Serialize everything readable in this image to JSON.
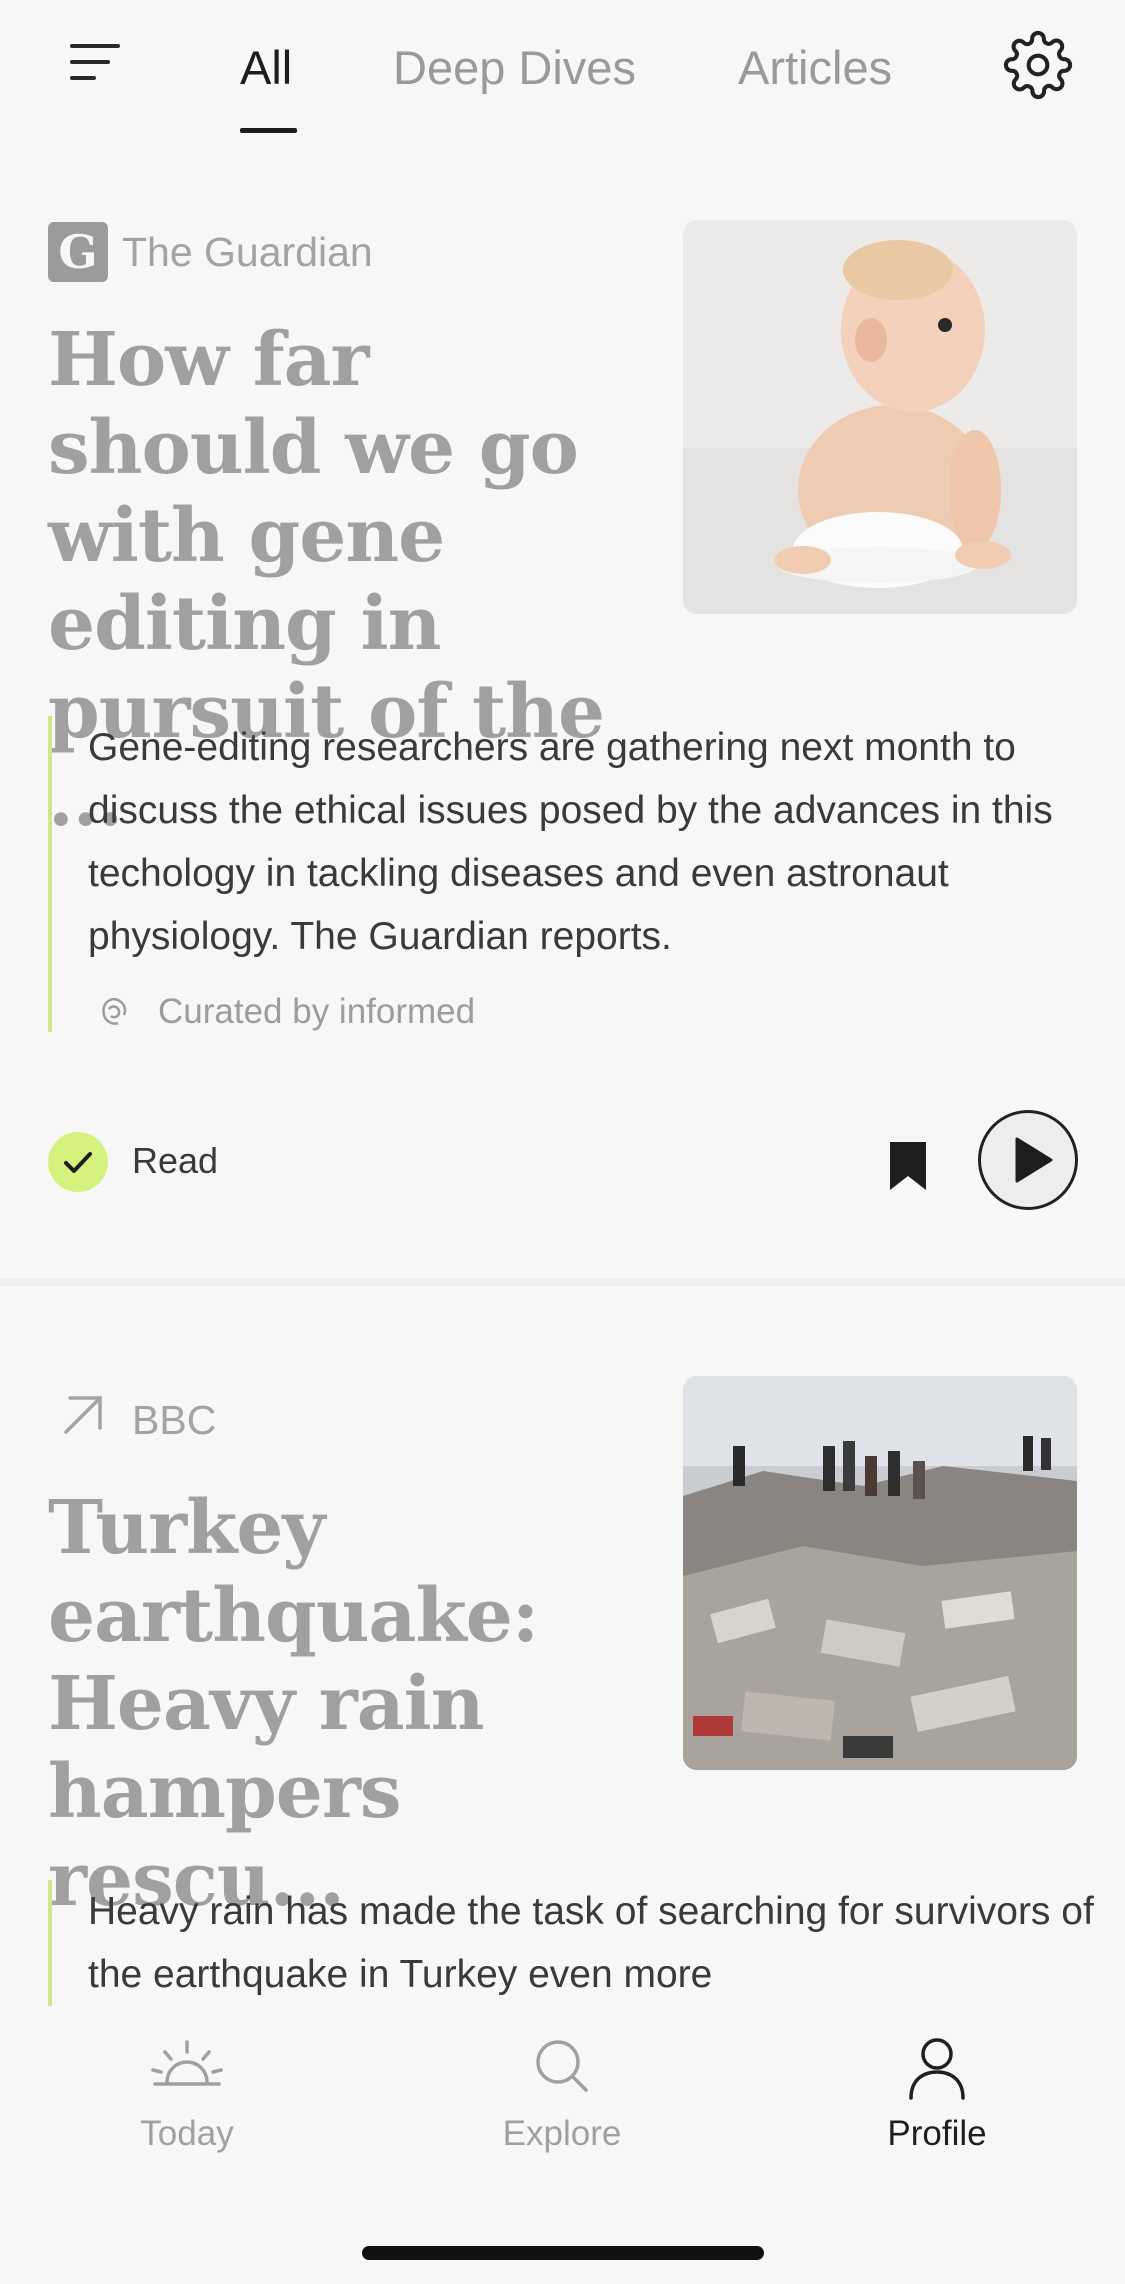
{
  "tabs": [
    {
      "label": "All",
      "active": true
    },
    {
      "label": "Deep Dives",
      "active": false
    },
    {
      "label": "Articles",
      "active": false
    }
  ],
  "cards": [
    {
      "source": "The Guardian",
      "source_logo": "G",
      "title": "How far should we go with gene editing in pursuit of the ...",
      "summary": "Gene-editing researchers are gathering next month to discuss the ethical issues posed by the advances in this techology in tackling diseases and even astronaut physiology. The Guardian reports.",
      "curated": "Curated by informed",
      "read_label": "Read",
      "image": "baby-photo"
    },
    {
      "source": "BBC",
      "title": "Turkey earthquake: Heavy rain hampers rescu...",
      "summary": "Heavy rain has made the task of searching for survivors of the earthquake in Turkey even more",
      "image": "earthquake-rubble-photo"
    }
  ],
  "bottom_nav": [
    {
      "label": "Today",
      "icon": "sunrise-icon",
      "active": false
    },
    {
      "label": "Explore",
      "icon": "search-icon",
      "active": false
    },
    {
      "label": "Profile",
      "icon": "person-icon",
      "active": true
    }
  ],
  "colors": {
    "accent_green": "#d6f27e",
    "summary_border": "#cfe885",
    "background": "#f7f7f7"
  }
}
